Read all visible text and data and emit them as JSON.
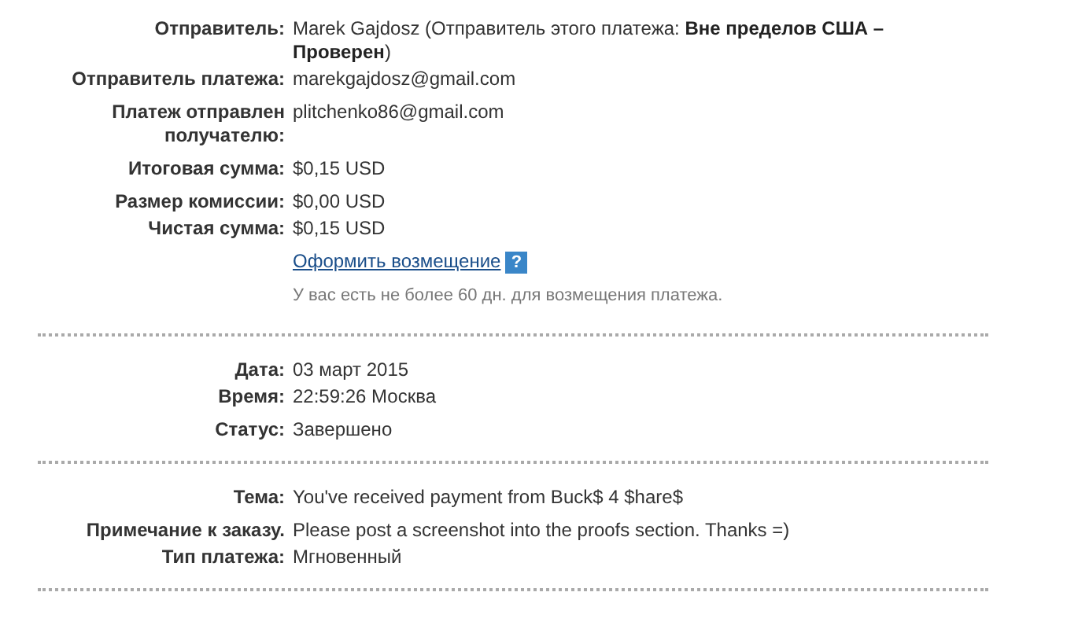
{
  "sections": [
    {
      "rows": [
        {
          "kind": "field",
          "label": "Отправитель:",
          "value": "Marek Gajdosz (Отправитель этого платежа: **Вне пределов США – Проверен**)"
        },
        {
          "kind": "field",
          "label": "Отправитель платежа:",
          "value": "marekgajdosz@gmail.com"
        },
        {
          "kind": "field",
          "label": "Платеж отправлен получателю:",
          "value": "plitchenko86@gmail.com"
        },
        {
          "kind": "field",
          "label": "Итоговая сумма:",
          "value": "$0,15 USD"
        },
        {
          "kind": "field",
          "label": "Размер комиссии:",
          "value": "$0,00 USD"
        },
        {
          "kind": "field",
          "label": "Чистая сумма:",
          "value": "$0,15 USD"
        },
        {
          "kind": "link",
          "value": "Оформить возмещение",
          "help": "?"
        },
        {
          "kind": "note",
          "value": "У вас есть не более 60 дн. для возмещения платежа."
        }
      ]
    },
    {
      "rows": [
        {
          "kind": "field",
          "label": "Дата:",
          "value": "03 март 2015"
        },
        {
          "kind": "field",
          "label": "Время:",
          "value": "22:59:26 Москва"
        },
        {
          "kind": "field",
          "label": "Статус:",
          "value": "Завершено"
        }
      ]
    },
    {
      "rows": [
        {
          "kind": "field",
          "label": "Тема:",
          "value": "You've received payment from Buck$ 4 $hare$"
        },
        {
          "kind": "field",
          "label": "Примечание к заказу.",
          "value": "Please post a screenshot into the proofs section. Thanks =)"
        },
        {
          "kind": "field",
          "label": "Тип платежа:",
          "value": "Мгновенный"
        }
      ]
    }
  ]
}
